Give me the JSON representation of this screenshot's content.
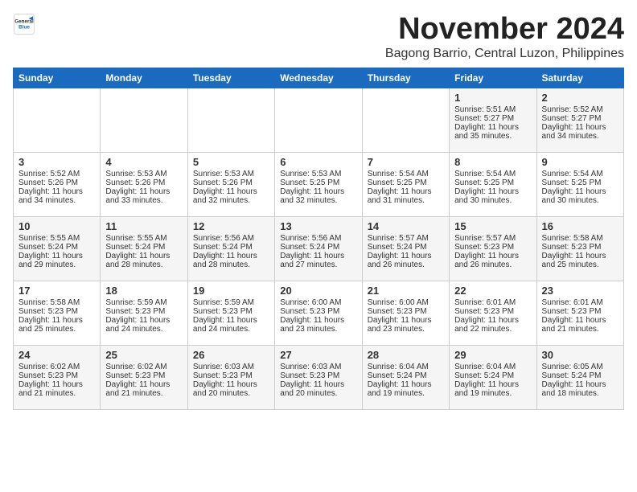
{
  "logo": {
    "general": "General",
    "blue": "Blue"
  },
  "title": {
    "month": "November 2024",
    "location": "Bagong Barrio, Central Luzon, Philippines"
  },
  "headers": [
    "Sunday",
    "Monday",
    "Tuesday",
    "Wednesday",
    "Thursday",
    "Friday",
    "Saturday"
  ],
  "weeks": [
    [
      {
        "day": "",
        "content": ""
      },
      {
        "day": "",
        "content": ""
      },
      {
        "day": "",
        "content": ""
      },
      {
        "day": "",
        "content": ""
      },
      {
        "day": "",
        "content": ""
      },
      {
        "day": "1",
        "content": "Sunrise: 5:51 AM\nSunset: 5:27 PM\nDaylight: 11 hours\nand 35 minutes."
      },
      {
        "day": "2",
        "content": "Sunrise: 5:52 AM\nSunset: 5:27 PM\nDaylight: 11 hours\nand 34 minutes."
      }
    ],
    [
      {
        "day": "3",
        "content": "Sunrise: 5:52 AM\nSunset: 5:26 PM\nDaylight: 11 hours\nand 34 minutes."
      },
      {
        "day": "4",
        "content": "Sunrise: 5:53 AM\nSunset: 5:26 PM\nDaylight: 11 hours\nand 33 minutes."
      },
      {
        "day": "5",
        "content": "Sunrise: 5:53 AM\nSunset: 5:26 PM\nDaylight: 11 hours\nand 32 minutes."
      },
      {
        "day": "6",
        "content": "Sunrise: 5:53 AM\nSunset: 5:25 PM\nDaylight: 11 hours\nand 32 minutes."
      },
      {
        "day": "7",
        "content": "Sunrise: 5:54 AM\nSunset: 5:25 PM\nDaylight: 11 hours\nand 31 minutes."
      },
      {
        "day": "8",
        "content": "Sunrise: 5:54 AM\nSunset: 5:25 PM\nDaylight: 11 hours\nand 30 minutes."
      },
      {
        "day": "9",
        "content": "Sunrise: 5:54 AM\nSunset: 5:25 PM\nDaylight: 11 hours\nand 30 minutes."
      }
    ],
    [
      {
        "day": "10",
        "content": "Sunrise: 5:55 AM\nSunset: 5:24 PM\nDaylight: 11 hours\nand 29 minutes."
      },
      {
        "day": "11",
        "content": "Sunrise: 5:55 AM\nSunset: 5:24 PM\nDaylight: 11 hours\nand 28 minutes."
      },
      {
        "day": "12",
        "content": "Sunrise: 5:56 AM\nSunset: 5:24 PM\nDaylight: 11 hours\nand 28 minutes."
      },
      {
        "day": "13",
        "content": "Sunrise: 5:56 AM\nSunset: 5:24 PM\nDaylight: 11 hours\nand 27 minutes."
      },
      {
        "day": "14",
        "content": "Sunrise: 5:57 AM\nSunset: 5:24 PM\nDaylight: 11 hours\nand 26 minutes."
      },
      {
        "day": "15",
        "content": "Sunrise: 5:57 AM\nSunset: 5:23 PM\nDaylight: 11 hours\nand 26 minutes."
      },
      {
        "day": "16",
        "content": "Sunrise: 5:58 AM\nSunset: 5:23 PM\nDaylight: 11 hours\nand 25 minutes."
      }
    ],
    [
      {
        "day": "17",
        "content": "Sunrise: 5:58 AM\nSunset: 5:23 PM\nDaylight: 11 hours\nand 25 minutes."
      },
      {
        "day": "18",
        "content": "Sunrise: 5:59 AM\nSunset: 5:23 PM\nDaylight: 11 hours\nand 24 minutes."
      },
      {
        "day": "19",
        "content": "Sunrise: 5:59 AM\nSunset: 5:23 PM\nDaylight: 11 hours\nand 24 minutes."
      },
      {
        "day": "20",
        "content": "Sunrise: 6:00 AM\nSunset: 5:23 PM\nDaylight: 11 hours\nand 23 minutes."
      },
      {
        "day": "21",
        "content": "Sunrise: 6:00 AM\nSunset: 5:23 PM\nDaylight: 11 hours\nand 23 minutes."
      },
      {
        "day": "22",
        "content": "Sunrise: 6:01 AM\nSunset: 5:23 PM\nDaylight: 11 hours\nand 22 minutes."
      },
      {
        "day": "23",
        "content": "Sunrise: 6:01 AM\nSunset: 5:23 PM\nDaylight: 11 hours\nand 21 minutes."
      }
    ],
    [
      {
        "day": "24",
        "content": "Sunrise: 6:02 AM\nSunset: 5:23 PM\nDaylight: 11 hours\nand 21 minutes."
      },
      {
        "day": "25",
        "content": "Sunrise: 6:02 AM\nSunset: 5:23 PM\nDaylight: 11 hours\nand 21 minutes."
      },
      {
        "day": "26",
        "content": "Sunrise: 6:03 AM\nSunset: 5:23 PM\nDaylight: 11 hours\nand 20 minutes."
      },
      {
        "day": "27",
        "content": "Sunrise: 6:03 AM\nSunset: 5:23 PM\nDaylight: 11 hours\nand 20 minutes."
      },
      {
        "day": "28",
        "content": "Sunrise: 6:04 AM\nSunset: 5:24 PM\nDaylight: 11 hours\nand 19 minutes."
      },
      {
        "day": "29",
        "content": "Sunrise: 6:04 AM\nSunset: 5:24 PM\nDaylight: 11 hours\nand 19 minutes."
      },
      {
        "day": "30",
        "content": "Sunrise: 6:05 AM\nSunset: 5:24 PM\nDaylight: 11 hours\nand 18 minutes."
      }
    ]
  ]
}
